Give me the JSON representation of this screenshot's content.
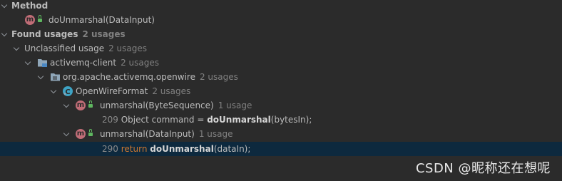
{
  "tree": {
    "method_header": "Method",
    "method_item": "doUnmarshal(DataInput)",
    "found_usages": {
      "label": "Found usages",
      "count": "2 usages"
    },
    "unclassified": {
      "label": "Unclassified usage",
      "count": "2 usages"
    },
    "module": {
      "label": "activemq-client",
      "count": "2 usages"
    },
    "package": {
      "label": "org.apache.activemq.openwire",
      "count": "2 usages"
    },
    "class": {
      "label": "OpenWireFormat",
      "count": "2 usages"
    },
    "method1": {
      "label": "unmarshal(ByteSequence)",
      "count": "1 usage"
    },
    "usage1": {
      "line": "209",
      "pre": "Object command = ",
      "match": "doUnmarshal",
      "post": "(bytesIn);"
    },
    "method2": {
      "label": "unmarshal(DataInput)",
      "count": "1 usage"
    },
    "usage2": {
      "line": "290",
      "keyword": "return",
      "match": "doUnmarshal",
      "post": "(dataIn);"
    }
  },
  "icons": {
    "method_badge": "m",
    "class_badge": "C"
  },
  "watermark": "CSDN @昵称还在想呢",
  "colors": {
    "background": "#2b2b2b",
    "selection": "#0d293e",
    "method_badge": "#c16d77",
    "class_badge": "#3ea3c4",
    "keyword": "#cc7832"
  }
}
